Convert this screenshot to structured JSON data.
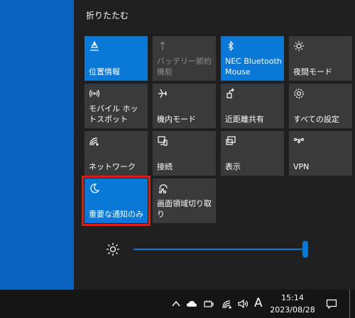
{
  "action_center": {
    "collapse_label": "折りたたむ",
    "tiles": [
      {
        "label": "位置情報",
        "icon": "location-icon",
        "state": "active"
      },
      {
        "label": "バッテリー節約機能",
        "icon": "battery-saver-icon",
        "state": "disabled"
      },
      {
        "label": "NEC Bluetooth Mouse",
        "icon": "bluetooth-icon",
        "state": "active"
      },
      {
        "label": "夜間モード",
        "icon": "night-light-icon",
        "state": "off"
      },
      {
        "label": "モバイル ホットスポット",
        "icon": "mobile-hotspot-icon",
        "state": "off"
      },
      {
        "label": "機内モード",
        "icon": "airplane-icon",
        "state": "off"
      },
      {
        "label": "近距離共有",
        "icon": "nearby-share-icon",
        "state": "off"
      },
      {
        "label": "すべての設定",
        "icon": "settings-gear-icon",
        "state": "off"
      },
      {
        "label": "ネットワーク",
        "icon": "network-icon",
        "state": "off"
      },
      {
        "label": "接続",
        "icon": "connect-icon",
        "state": "off"
      },
      {
        "label": "表示",
        "icon": "project-icon",
        "state": "off"
      },
      {
        "label": "VPN",
        "icon": "vpn-icon",
        "state": "off"
      },
      {
        "label": "重要な通知のみ",
        "icon": "focus-assist-moon-icon",
        "state": "active-focused"
      },
      {
        "label": "画面領域切り取り",
        "icon": "snip-icon",
        "state": "off"
      }
    ],
    "brightness_percent": 100
  },
  "taskbar": {
    "tray_icons": [
      "chevron-up-icon",
      "onedrive-cloud-icon",
      "power-plug-icon",
      "wifi-icon",
      "speaker-icon"
    ],
    "ime_mode": "A",
    "time": "15:14",
    "date": "2023/08/28"
  }
}
